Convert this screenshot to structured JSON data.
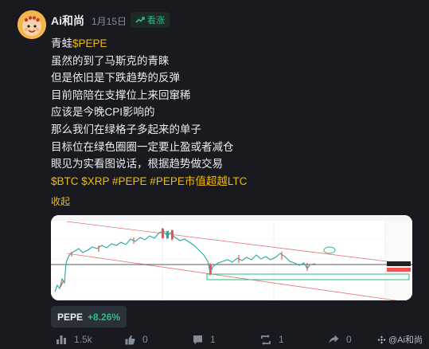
{
  "post": {
    "author": "Ai和尚",
    "date": "1月15日",
    "badge": "看涨",
    "lines": [
      {
        "parts": [
          {
            "text": "青蛙",
            "accent": false
          },
          {
            "text": "$PEPE",
            "accent": true
          }
        ]
      },
      {
        "parts": [
          {
            "text": "虽然的到了马斯克的青睐",
            "accent": false
          }
        ]
      },
      {
        "parts": [
          {
            "text": "但是依旧是下跌趋势的反弹",
            "accent": false
          }
        ]
      },
      {
        "parts": [
          {
            "text": "目前陪陪在支撑位上来回窜稀",
            "accent": false
          }
        ]
      },
      {
        "parts": [
          {
            "text": "应该是今晚CPI影响的",
            "accent": false
          }
        ]
      },
      {
        "parts": [
          {
            "text": "那么我们在绿格子多起来的单子",
            "accent": false
          }
        ]
      },
      {
        "parts": [
          {
            "text": "目标位在绿色圈圈一定要止盈或者减仓",
            "accent": false
          }
        ]
      },
      {
        "parts": [
          {
            "text": "眼见为实看图说话，根据趋势做交易",
            "accent": false
          }
        ]
      },
      {
        "parts": [
          {
            "text": "$BTC $XRP #PEPE #PEPE市值超越LTC",
            "accent": true
          }
        ]
      }
    ],
    "collapse_label": "收起"
  },
  "coin": {
    "symbol": "PEPE",
    "change": "+8.26%"
  },
  "actions": {
    "views": "1.5k",
    "likes": "0",
    "comments": "1",
    "reposts": "1",
    "shares": "0"
  },
  "watermark": "@Ai和尚",
  "colors": {
    "accent": "#f0b90b",
    "up": "#2ebd85",
    "background": "#181a20",
    "muted": "#848e9c"
  }
}
